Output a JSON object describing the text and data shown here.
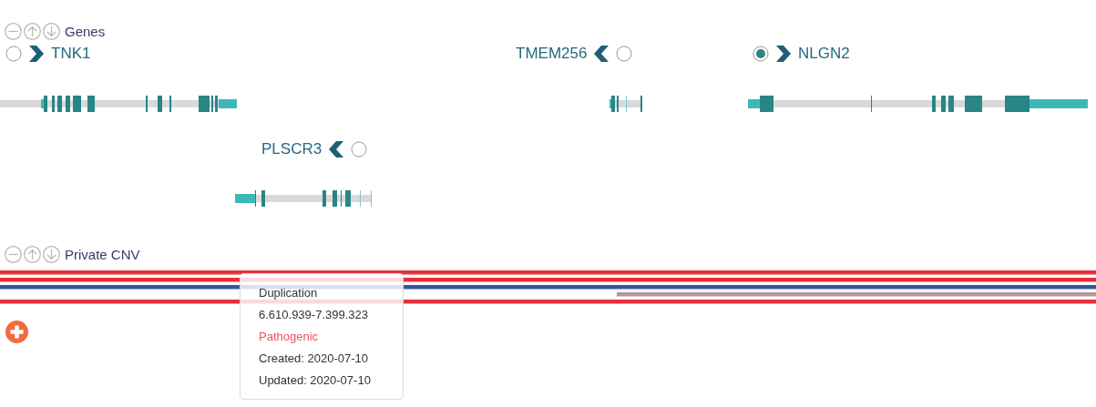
{
  "tracks": [
    {
      "kind": "genes",
      "title": "Genes",
      "genes": [
        {
          "name": "TNK1",
          "kind": "forward",
          "selected": false
        },
        {
          "name": "TMEM256",
          "kind": "reverse",
          "selected": false
        },
        {
          "name": "NLGN2",
          "kind": "forward",
          "selected": true
        },
        {
          "name": "PLSCR3",
          "kind": "reverse",
          "selected": false
        }
      ]
    },
    {
      "kind": "cnv",
      "title": "Private CNV",
      "variants": [
        {
          "color": "#e8303c"
        },
        {
          "color": "#e8303c"
        },
        {
          "color": "#34589a"
        },
        {
          "color": "#b3979a"
        },
        {
          "color": "#e8303c"
        }
      ]
    }
  ],
  "tooltip": {
    "type": "Duplication",
    "range": "6.610.939-7.399.323",
    "classification": "Pathogenic",
    "created": "Created: 2020-07-10",
    "updated": "Updated: 2020-07-10"
  }
}
